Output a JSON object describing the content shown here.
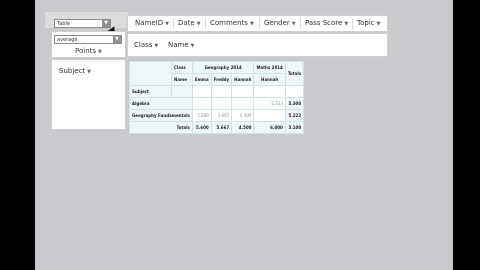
{
  "filters": {
    "top_select": "Table",
    "aggregate_select": "average"
  },
  "values_area": {
    "field": "Points"
  },
  "rows_area": {
    "field": "Subject"
  },
  "unused_fields": [
    "NameID",
    "Date",
    "Comments",
    "Gender",
    "Pass Score",
    "Topic"
  ],
  "column_fields": [
    "Class",
    "Name"
  ],
  "pivot": {
    "corner_row_labels": [
      "Class",
      "Name"
    ],
    "subject_label": "Subject",
    "classes": [
      "Geography 2014",
      "Maths 2014"
    ],
    "names": [
      "Emma",
      "Freddy",
      "Hannah",
      "Hannah"
    ],
    "totals_label": "Totals",
    "rows": [
      {
        "subject": "Algebra",
        "values": [
          "",
          "",
          "",
          "5.333"
        ],
        "total": "5.300"
      },
      {
        "subject": "Geography Fundamentals",
        "values": [
          "5.500",
          "5.667",
          "4.500",
          ""
        ],
        "total": "5.222"
      }
    ],
    "totals_row": {
      "values": [
        "5.600",
        "5.667",
        "4.500",
        "6.000"
      ],
      "total": "5.100"
    }
  },
  "colors": {
    "page_bg": "#000000",
    "stage_bg": "#c9c9ce",
    "panel_bg": "#ffffff",
    "header_cell_bg": "#eef6f9"
  }
}
